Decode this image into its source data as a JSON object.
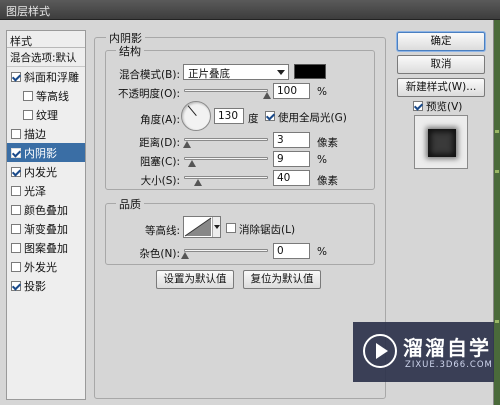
{
  "window": {
    "title": "图层样式"
  },
  "style_list": {
    "header": "样式",
    "blend_item": "混合选项:默认",
    "items": [
      {
        "label": "斜面和浮雕",
        "checked": true
      },
      {
        "label": "等高线",
        "checked": false
      },
      {
        "label": "纹理",
        "checked": false
      },
      {
        "label": "描边",
        "checked": false
      },
      {
        "label": "内阴影",
        "checked": true,
        "selected": true
      },
      {
        "label": "内发光",
        "checked": true
      },
      {
        "label": "光泽",
        "checked": false
      },
      {
        "label": "颜色叠加",
        "checked": false
      },
      {
        "label": "渐变叠加",
        "checked": false
      },
      {
        "label": "图案叠加",
        "checked": false
      },
      {
        "label": "外发光",
        "checked": false
      },
      {
        "label": "投影",
        "checked": true
      }
    ]
  },
  "panel": {
    "title": "内阴影",
    "structure": {
      "label": "结构",
      "blend_mode_label": "混合模式(B):",
      "blend_mode_value": "正片叠底",
      "color": "#000000",
      "opacity_label": "不透明度(O):",
      "opacity_value": "100",
      "opacity_unit": "%",
      "opacity_level": 1.0,
      "angle_label": "角度(A):",
      "angle_value": "130",
      "angle_unit": "度",
      "global_light_label": "使用全局光(G)",
      "global_light_checked": true,
      "distance_label": "距离(D):",
      "distance_value": "3",
      "distance_unit": "像素",
      "distance_level": 0.03,
      "choke_label": "阻塞(C):",
      "choke_value": "9",
      "choke_unit": "%",
      "choke_level": 0.09,
      "size_label": "大小(S):",
      "size_value": "40",
      "size_unit": "像素",
      "size_level": 0.16
    },
    "quality": {
      "label": "品质",
      "contour_label": "等高线:",
      "antialias_label": "消除锯齿(L)",
      "antialias_checked": false,
      "noise_label": "杂色(N):",
      "noise_value": "0",
      "noise_unit": "%",
      "noise_level": 0.0
    },
    "set_default_label": "设置为默认值",
    "reset_default_label": "复位为默认值"
  },
  "buttons": {
    "ok": "确定",
    "cancel": "取消",
    "new_style": "新建样式(W)...",
    "preview_label": "预览(V)",
    "preview_checked": true
  },
  "watermark": {
    "name": "溜溜自学",
    "url": "ZIXUE.3D66.COM"
  }
}
